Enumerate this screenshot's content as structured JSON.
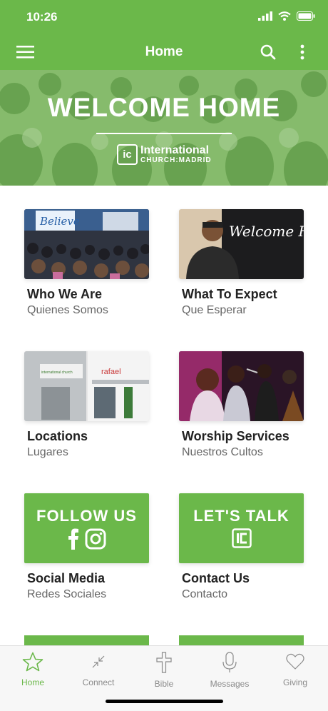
{
  "status": {
    "time": "10:26"
  },
  "header": {
    "title": "Home"
  },
  "hero": {
    "headline": "WELCOME HOME",
    "logo_line1": "International",
    "logo_line2": "CHURCH:MADRID",
    "logo_mark": "ic"
  },
  "cards": [
    {
      "title": "Who We Are",
      "subtitle": "Quienes Somos",
      "banner_text": "Believe"
    },
    {
      "title": "What To Expect",
      "subtitle": "Que Esperar",
      "banner_text": "Welcome Home"
    },
    {
      "title": "Locations",
      "subtitle": "Lugares",
      "sign_text_1": "international church",
      "sign_text_2": "rafael"
    },
    {
      "title": "Worship Services",
      "subtitle": "Nuestros Cultos"
    },
    {
      "title": "Social Media",
      "subtitle": "Redes Sociales",
      "promo_text": "FOLLOW US",
      "icons": [
        "facebook-icon",
        "instagram-icon"
      ]
    },
    {
      "title": "Contact Us",
      "subtitle": "Contacto",
      "promo_text": "LET'S TALK",
      "icons": [
        "church-logo-icon"
      ]
    }
  ],
  "tabs": [
    {
      "label": "Home",
      "icon": "star-icon",
      "active": true
    },
    {
      "label": "Connect",
      "icon": "compress-arrows-icon",
      "active": false
    },
    {
      "label": "Bible",
      "icon": "cross-icon",
      "active": false
    },
    {
      "label": "Messages",
      "icon": "microphone-icon",
      "active": false
    },
    {
      "label": "Giving",
      "icon": "heart-icon",
      "active": false
    }
  ],
  "colors": {
    "brand_green": "#6bb84a",
    "inactive_gray": "#8a8a8a",
    "text_dark": "#222222",
    "text_sub": "#666666"
  }
}
